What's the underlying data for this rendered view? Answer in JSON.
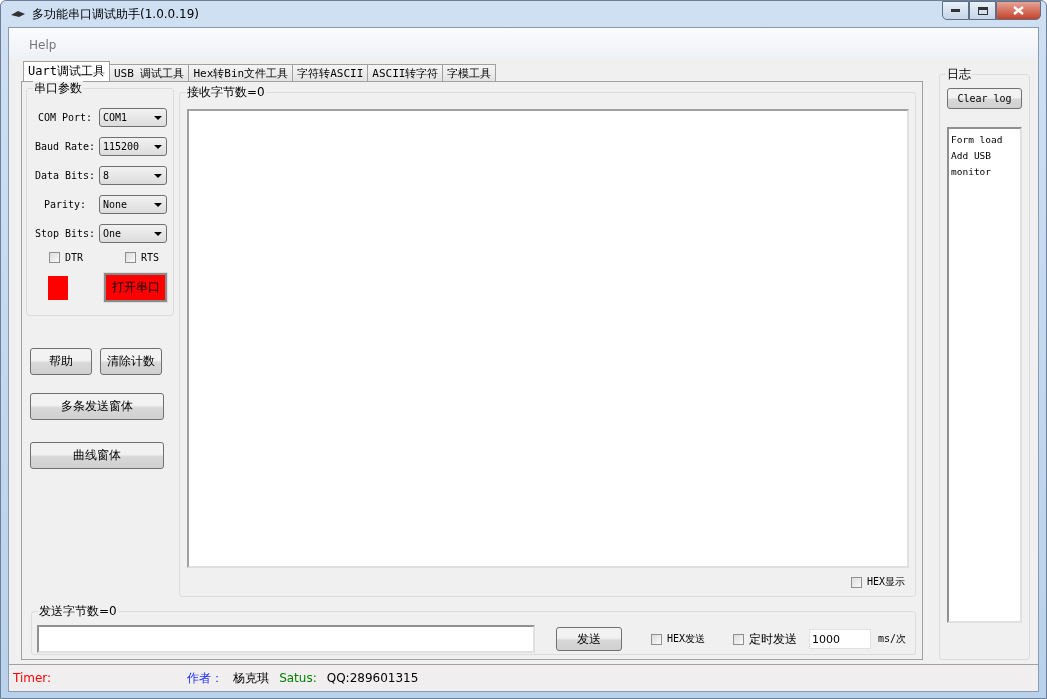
{
  "window": {
    "title": "多功能串口调试助手(1.0.0.19)"
  },
  "menu": [
    "Help"
  ],
  "tabs": [
    {
      "label": "Uart调试工具",
      "selected": true
    },
    {
      "label": "USB 调试工具",
      "selected": false
    },
    {
      "label": "Hex转Bin文件工具",
      "selected": false
    },
    {
      "label": "字符转ASCII",
      "selected": false
    },
    {
      "label": "ASCII转字符",
      "selected": false
    },
    {
      "label": "字模工具",
      "selected": false
    }
  ],
  "serial_params": {
    "title": "串口参数",
    "fields": [
      {
        "label": "COM Port:",
        "value": "COM1"
      },
      {
        "label": "Baud Rate:",
        "value": "115200"
      },
      {
        "label": "Data Bits:",
        "value": "8"
      },
      {
        "label": "Parity:",
        "value": "None"
      },
      {
        "label": "Stop Bits:",
        "value": "One"
      }
    ],
    "checkboxes": [
      {
        "label": "DTR",
        "checked": false
      },
      {
        "label": "RTS",
        "checked": false
      }
    ],
    "port_open": false,
    "open_button": "打开串口"
  },
  "buttons": [
    "帮助",
    "清除计数",
    "多条发送窗体",
    "曲线窗体"
  ],
  "receive": {
    "title": "接收字节数=0",
    "hex_display": {
      "label": "HEX显示",
      "checked": false
    }
  },
  "send": {
    "title": "发送字节数=0",
    "send_button": "发送",
    "hex_send": {
      "label": "HEX发送",
      "checked": false
    },
    "timed_send": {
      "label": "定时发送",
      "checked": false
    },
    "interval": "1000",
    "unit": "ms/次"
  },
  "log": {
    "title": "日志",
    "clear_button": "Clear log",
    "lines": [
      "Form load",
      "Add USB",
      "monitor"
    ]
  },
  "status_bar": {
    "timer_label": "Timer:",
    "author_label": "作者：",
    "author": "杨克琪",
    "status_label": "Satus:",
    "status": "QQ:289601315"
  }
}
